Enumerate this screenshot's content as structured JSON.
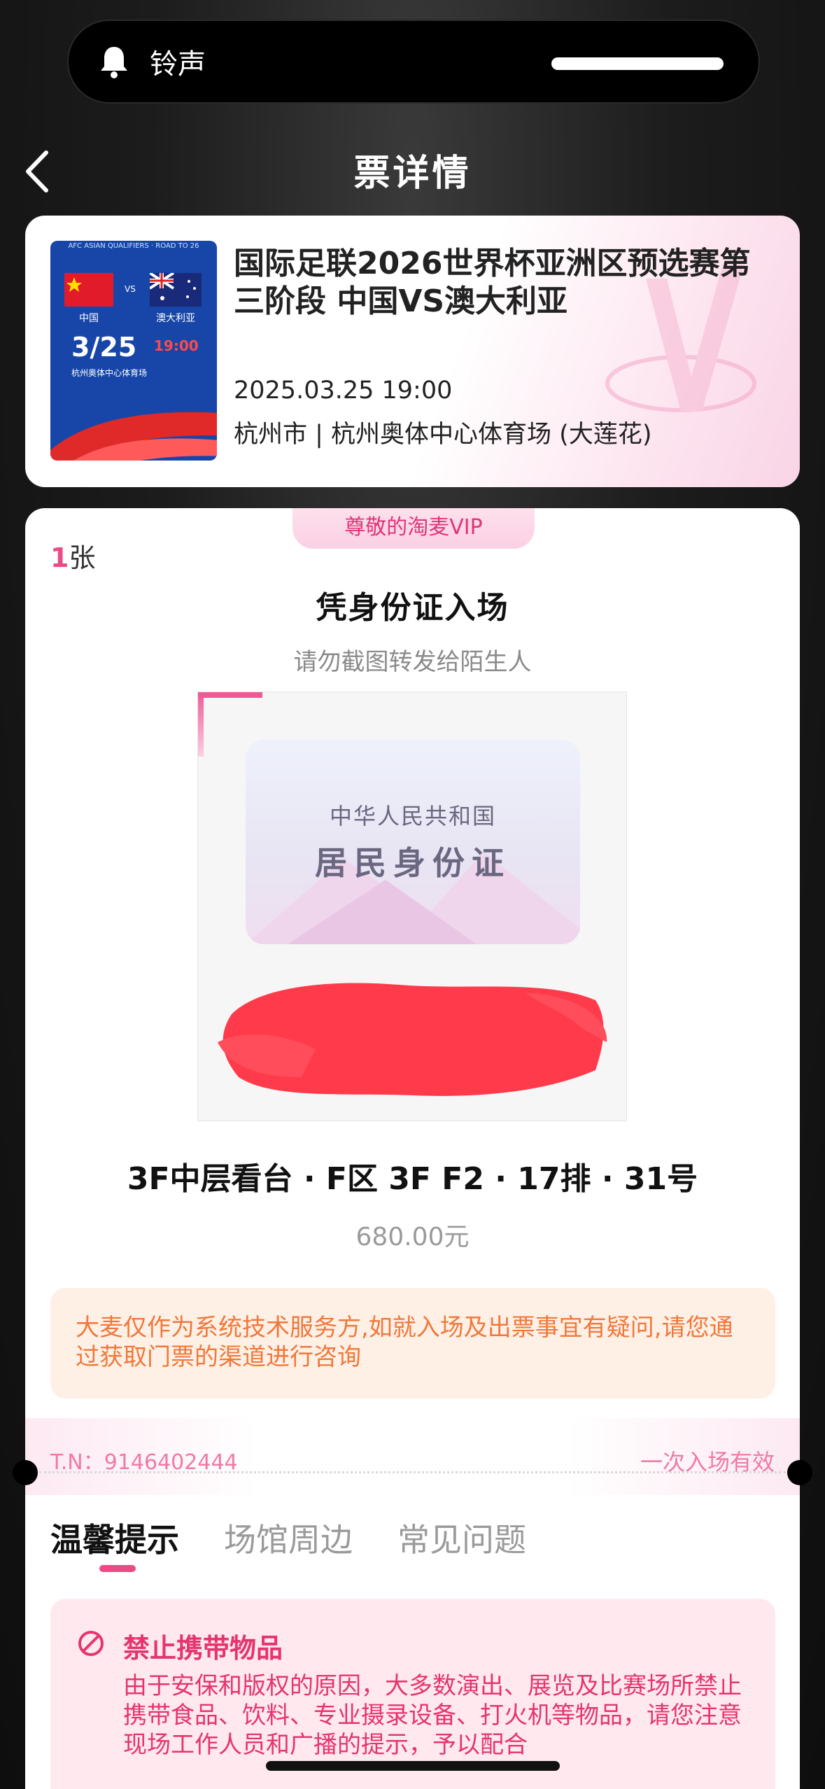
{
  "notification": {
    "text": "铃声"
  },
  "header": {
    "title": "票详情"
  },
  "event": {
    "title": "国际足联2026世界杯亚洲区预选赛第三阶段 中国VS澳大利亚",
    "datetime": "2025.03.25 19:00",
    "venue": "杭州市 | 杭州奥体中心体育场 (大莲花)",
    "poster": {
      "header": "AFC ASIAN QUALIFIERS · ROAD TO 26",
      "team1": "中国",
      "team2": "澳大利亚",
      "vs": "VS",
      "date": "3/25",
      "time": "19:00",
      "venue": "杭州奥体中心体育场"
    }
  },
  "ticket": {
    "vip_label": "尊敬的淘麦VIP",
    "count_num": "1",
    "count_unit": "张",
    "entry_title": "凭身份证入场",
    "warning": "请勿截图转发给陌生人",
    "id_card": {
      "line1": "中华人民共和国",
      "line2": "居民身份证"
    },
    "seat": "3F中层看台 · F区 3F F2 · 17排 · 31号",
    "price": "680.00元",
    "notice": "大麦仅作为系统技术服务方,如就入场及出票事宜有疑问,请您通过获取门票的渠道进行咨询",
    "tn": "T.N：9146402444",
    "validity": "一次入场有效"
  },
  "tabs": [
    {
      "label": "温馨提示"
    },
    {
      "label": "场馆周边"
    },
    {
      "label": "常见问题"
    }
  ],
  "tips": {
    "heading": "禁止携带物品",
    "body": "由于安保和版权的原因，大多数演出、展览及比赛场所禁止携带食品、饮料、专业摄录设备、打火机等物品，请您注意现场工作人员和广播的提示，予以配合"
  },
  "colors": {
    "accent": "#ec4a84",
    "notice_text": "#f0783a",
    "tips_text": "#e5356e",
    "redaction": "#ff3b4b"
  },
  "icons": [
    "bell-icon",
    "back-chevron-icon",
    "ban-icon"
  ]
}
